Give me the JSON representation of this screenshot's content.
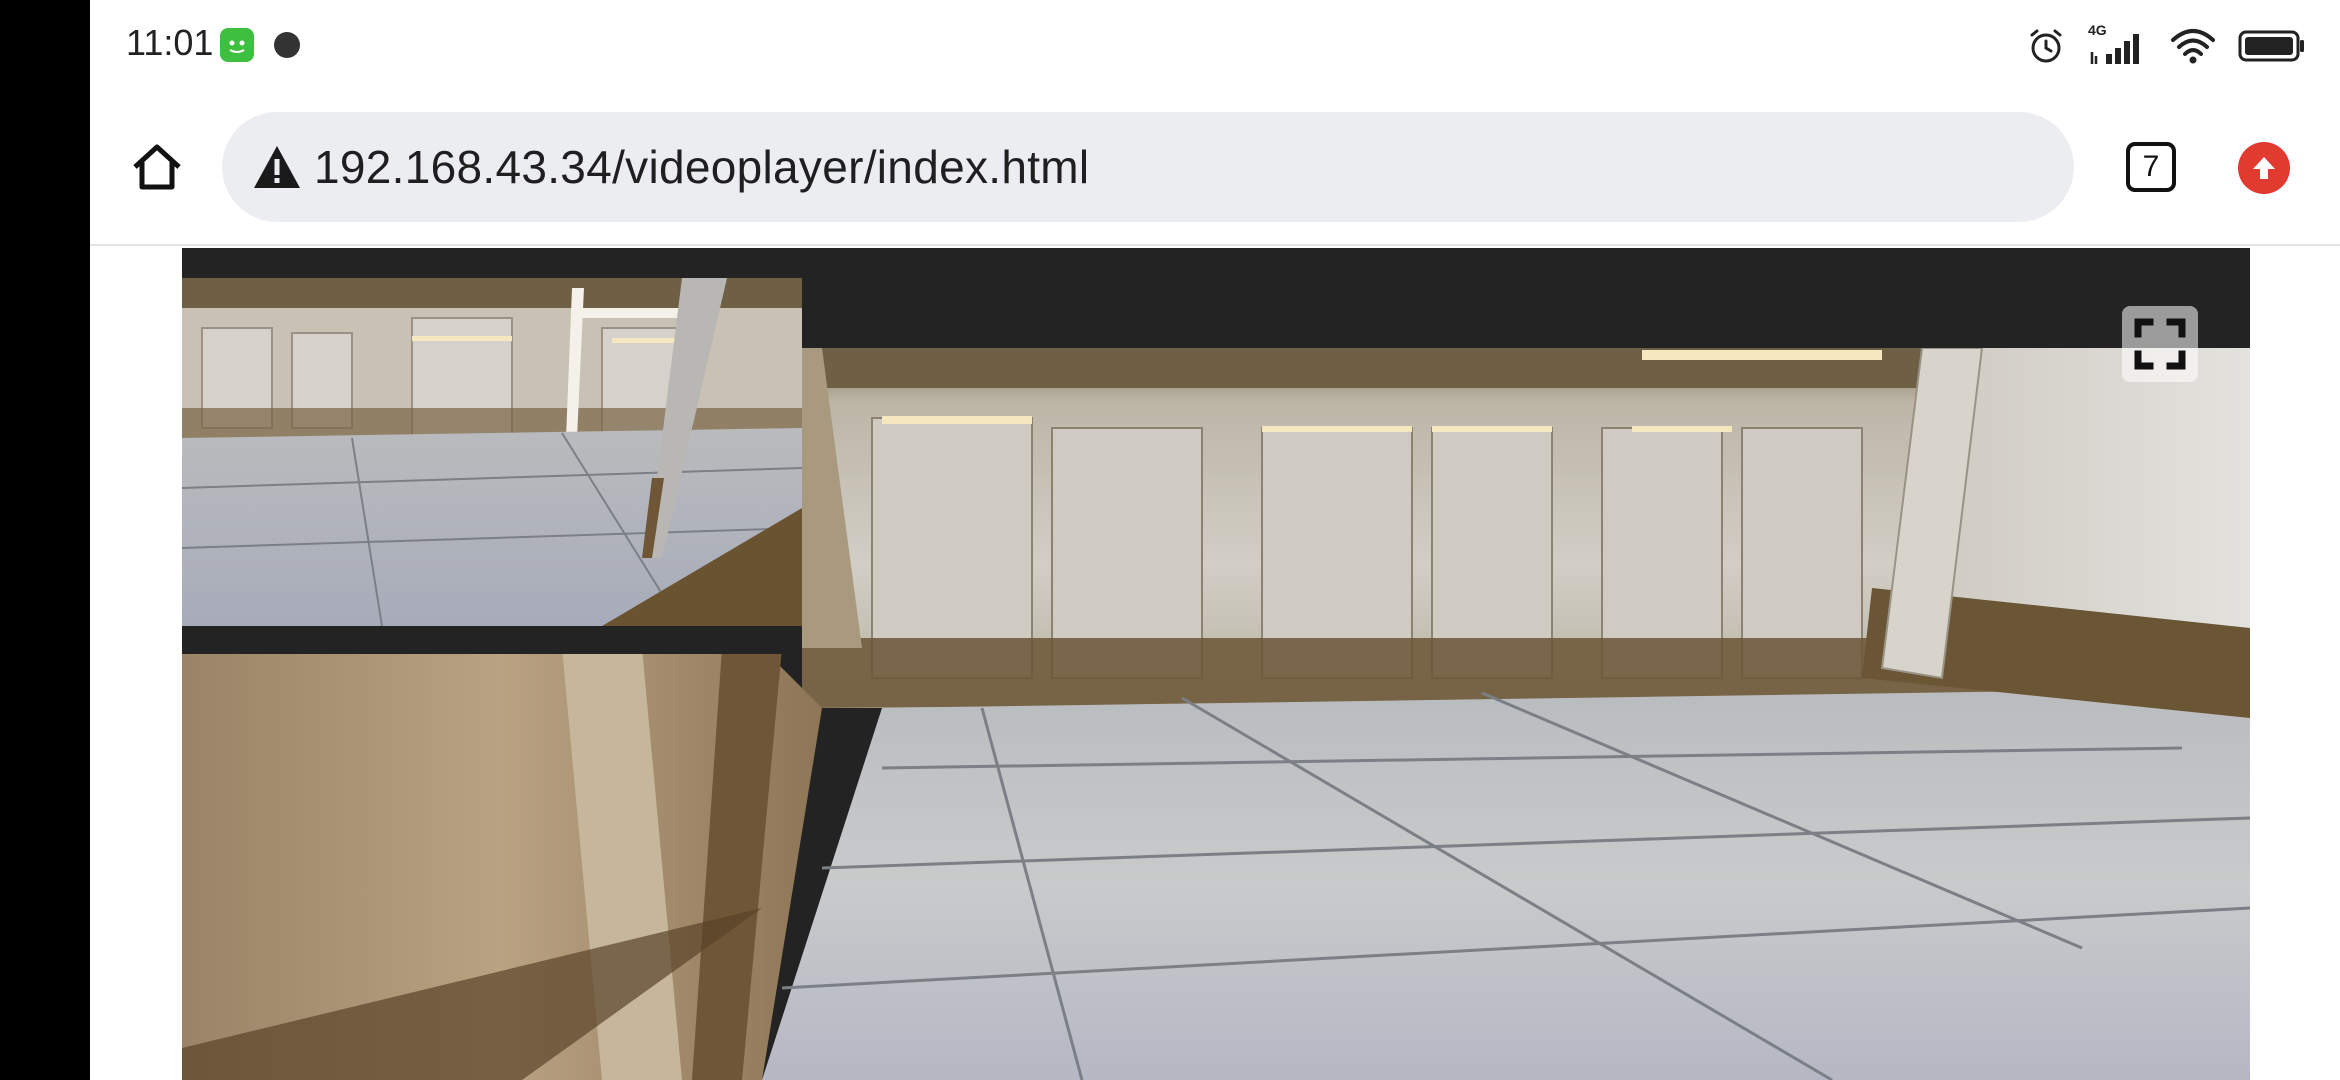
{
  "status_bar": {
    "time": "11:01",
    "network_label": "4G",
    "icons": [
      "alarm-icon",
      "signal-icon",
      "wifi-icon",
      "battery-icon"
    ]
  },
  "browser": {
    "url": "192.168.43.34/videoplayer/index.html",
    "tab_count": "7",
    "security_state_icon": "warning-icon",
    "accent_update_color": "#e03b2e"
  },
  "video_player": {
    "controls": [
      "fullscreen-icon"
    ]
  }
}
